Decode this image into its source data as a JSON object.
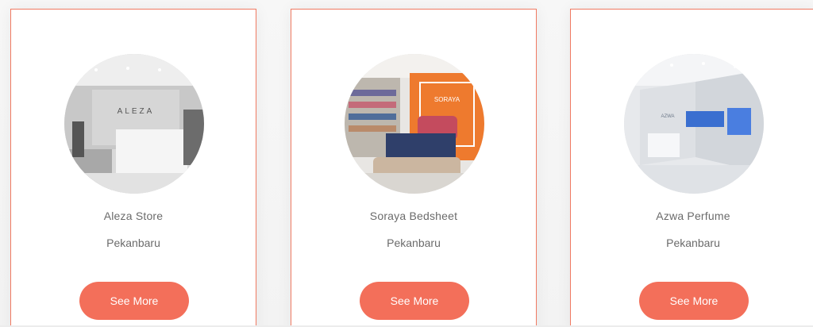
{
  "stores": [
    {
      "name": "Aleza Store",
      "city": "Pekanbaru",
      "button": "See More",
      "photo": "aleza-store-photo",
      "sign": "ALEZA"
    },
    {
      "name": "Soraya Bedsheet",
      "city": "Pekanbaru",
      "button": "See More",
      "photo": "soraya-bedsheet-store-photo",
      "sign": "SORAYA"
    },
    {
      "name": "Azwa Perfume",
      "city": "Pekanbaru",
      "button": "See More",
      "photo": "azwa-perfume-store-photo",
      "sign": "AZWA"
    }
  ],
  "colors": {
    "accent": "#f36f5a",
    "card_border": "#f07a62",
    "text": "#6b6b6b"
  }
}
